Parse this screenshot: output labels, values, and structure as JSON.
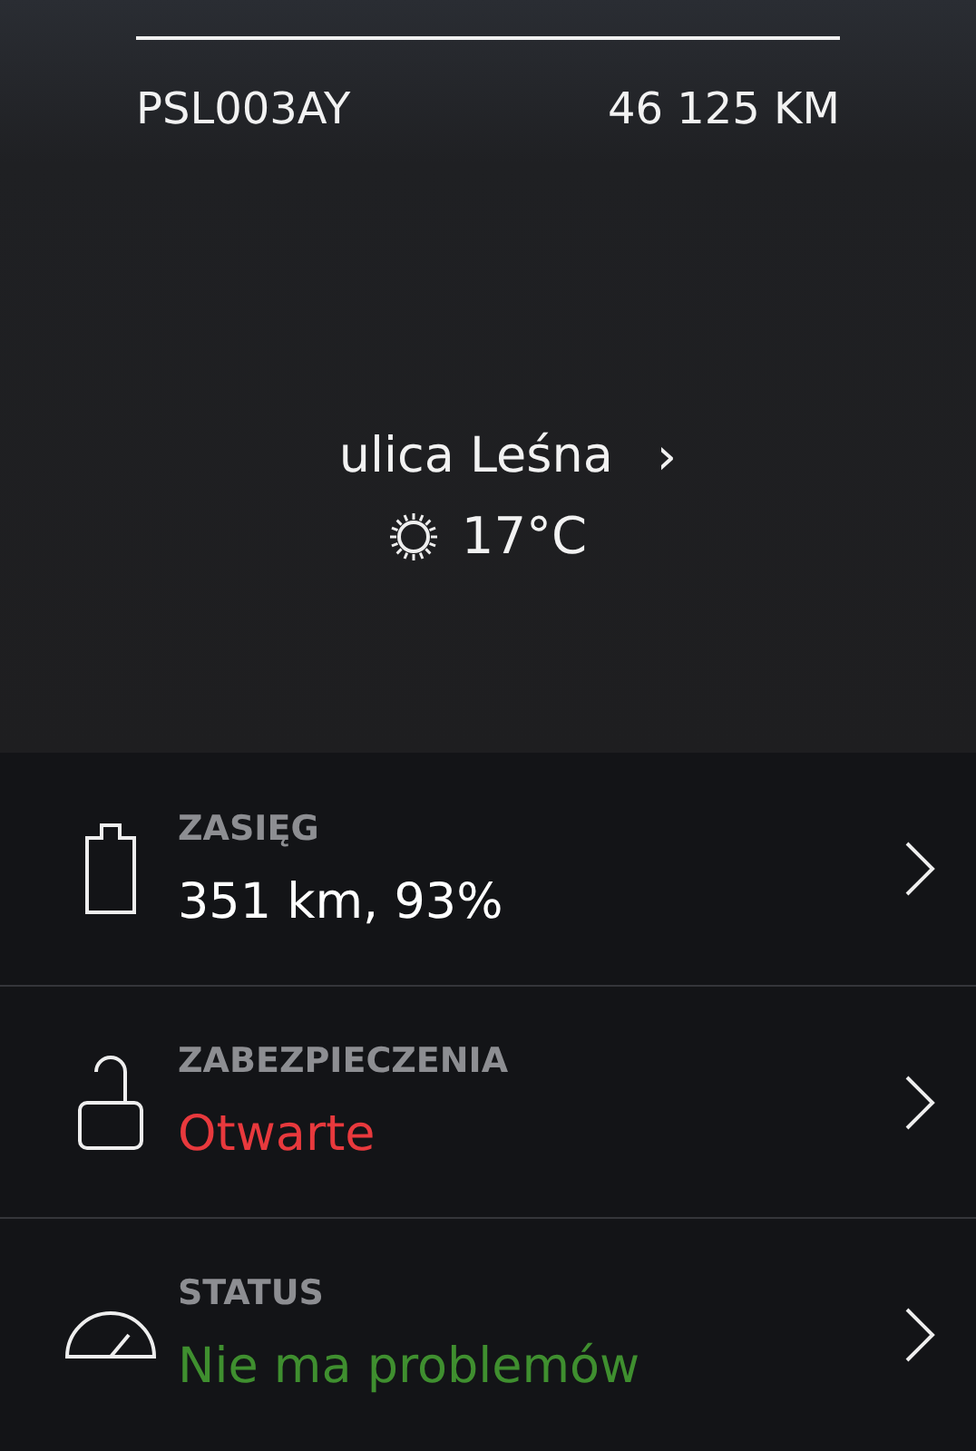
{
  "vehicle": {
    "plate": "PSL003AY",
    "mileage": "46 125 KM"
  },
  "location": {
    "street": "ulica Leśna",
    "chevron": "›",
    "temperature": "17°C"
  },
  "rows": [
    {
      "kind": "battery",
      "title": "ZASIĘG",
      "value": "351 km, 93%",
      "color": "#ffffff"
    },
    {
      "kind": "lock",
      "title": "ZABEZPIECZENIA",
      "value": "Otwarte",
      "color": "#e8393d"
    },
    {
      "kind": "gauge",
      "title": "STATUS",
      "value": "Nie ma problemów",
      "color": "#3f8f2f"
    }
  ]
}
